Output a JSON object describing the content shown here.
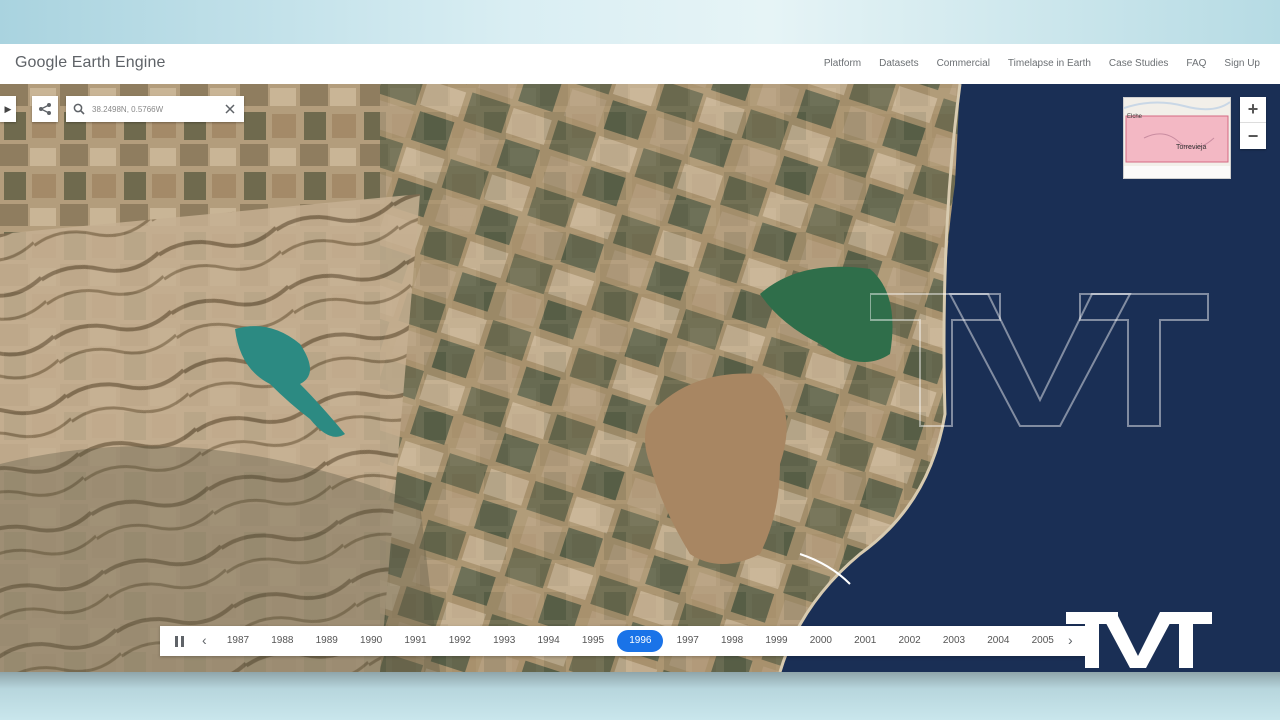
{
  "header": {
    "logo_text": "Google Earth Engine",
    "nav": [
      "Platform",
      "Datasets",
      "Commercial",
      "Timelapse in Earth",
      "Case Studies",
      "FAQ",
      "Sign Up"
    ]
  },
  "search": {
    "value": "38.2498N, 0.5766W",
    "share_icon": "share-icon",
    "search_icon": "search-icon",
    "clear_icon": "close-icon"
  },
  "minimap": {
    "label_left": "Elche",
    "label_right": "Torrevieja"
  },
  "zoom": {
    "in_label": "+",
    "out_label": "−"
  },
  "timeline": {
    "years": [
      "1987",
      "1988",
      "1989",
      "1990",
      "1991",
      "1992",
      "1993",
      "1994",
      "1995",
      "1996",
      "1997",
      "1998",
      "1999",
      "2000",
      "2001",
      "2002",
      "2003",
      "2004",
      "2005"
    ],
    "selected_year": "1996",
    "prev_label": "‹",
    "next_label": "›"
  },
  "watermark": {
    "text": "TVT"
  },
  "colors": {
    "accent": "#1a73e8",
    "sea": "#1a2f55",
    "land": "#b09a7a",
    "pink_lagoon": "#a88662",
    "green_lagoon": "#2f6e4a",
    "reservoir": "#2c8a82"
  }
}
